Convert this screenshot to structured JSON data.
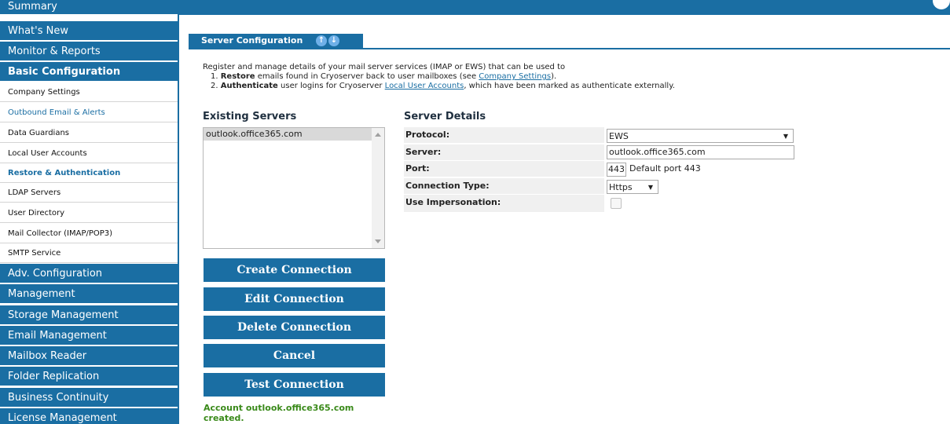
{
  "sidebar": {
    "top_item": "Summary",
    "items": [
      {
        "label": "What's New"
      },
      {
        "label": "Monitor & Reports"
      },
      {
        "label": "Basic Configuration"
      },
      {
        "label": "Company Settings"
      },
      {
        "label": "Outbound Email & Alerts"
      },
      {
        "label": "Data Guardians"
      },
      {
        "label": "Local User Accounts"
      },
      {
        "label": "Restore & Authentication"
      },
      {
        "label": "LDAP Servers"
      },
      {
        "label": "User Directory"
      },
      {
        "label": "Mail Collector (IMAP/POP3)"
      },
      {
        "label": "SMTP Service"
      },
      {
        "label": "Adv. Configuration"
      },
      {
        "label": "Management"
      },
      {
        "label": "Storage Management"
      },
      {
        "label": "Email Management"
      },
      {
        "label": "Mailbox Reader"
      },
      {
        "label": "Folder Replication"
      },
      {
        "label": "Business Continuity"
      },
      {
        "label": "License Management"
      }
    ]
  },
  "tab": {
    "label": "Server Configuration"
  },
  "intro": {
    "line1": "Register and manage details of your mail server services (IMAP or EWS) that can be used to",
    "item1_num": "1.",
    "item1_bold": "Restore",
    "item1_text": "emails found in Cryoserver back to user mailboxes (see",
    "item1_link": "Company Settings",
    "item1_end": ").",
    "item2_num": "2.",
    "item2_bold": "Authenticate",
    "item2_text": "user logins for Cryoserver",
    "item2_link": "Local User Accounts",
    "item2_end": ", which have been marked as authenticate externally."
  },
  "existing_servers": {
    "heading": "Existing Servers",
    "items": [
      "outlook.office365.com"
    ]
  },
  "buttons": {
    "create": "Create Connection",
    "edit": "Edit Connection",
    "delete": "Delete Connection",
    "cancel": "Cancel",
    "test": "Test Connection"
  },
  "status": {
    "message": "Account outlook.office365.com created."
  },
  "server_details": {
    "heading": "Server Details",
    "protocol_label": "Protocol:",
    "protocol_value": "EWS",
    "server_label": "Server:",
    "server_value": "outlook.office365.com",
    "port_label": "Port:",
    "port_value": "443",
    "port_hint": "Default port 443",
    "connection_type_label": "Connection Type:",
    "connection_type_value": "Https",
    "impersonation_label": "Use Impersonation:"
  },
  "colors": {
    "brand": "#1a6ea3",
    "success": "#3a8a1a",
    "label_bg": "#f0f0f0"
  },
  "icons": {
    "tab_arrow_up": "arrow-up-icon",
    "tab_arrow_down": "arrow-down-icon",
    "dropdown": "chevron-down-icon"
  }
}
